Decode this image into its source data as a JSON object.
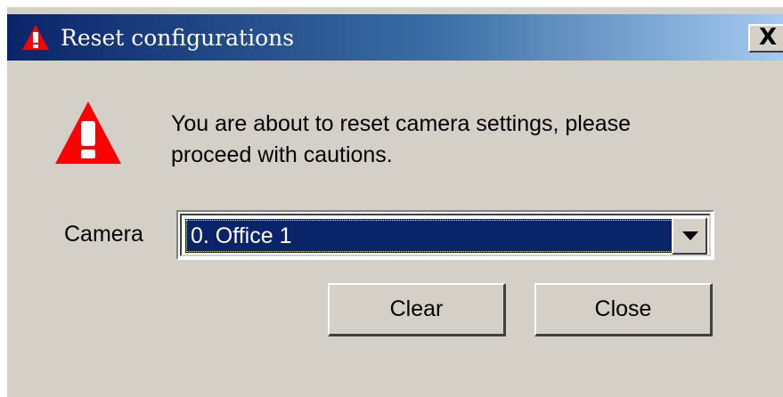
{
  "window": {
    "title": "Reset configurations",
    "title_icon": "warning-triangle-icon",
    "close_label": "X"
  },
  "message": {
    "icon": "warning-triangle-icon",
    "line1": "You are about to reset camera settings, please",
    "line2": "proceed with cautions."
  },
  "camera": {
    "label": "Camera",
    "selected": "0. Office 1"
  },
  "buttons": {
    "clear_label": "Clear",
    "close_label": "Close"
  },
  "colors": {
    "titlebar_start": "#0a246a",
    "titlebar_end": "#a6caf0",
    "selection": "#0a246a",
    "warning_red": "#ff0000"
  }
}
